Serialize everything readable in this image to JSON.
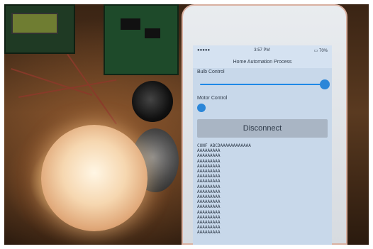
{
  "phone_app": {
    "status_time": "3:57 PM",
    "battery": "70%",
    "title": "Home Automation Process",
    "bulb_label": "Bulb Control",
    "bulb_slider_value": 1.0,
    "motor_label": "Motor Control",
    "disconnect_label": "Disconnect",
    "log_lines": [
      "CONF  ABCDAAAAAAAAAAAA",
      "AAAAAAAAA",
      "AAAAAAAAA",
      "AAAAAAAAA",
      "AAAAAAAAA",
      "AAAAAAAAA",
      "AAAAAAAAA",
      "AAAAAAAAA",
      "AAAAAAAAA",
      "AAAAAAAAA",
      "AAAAAAAAA",
      "AAAAAAAAA",
      "AAAAAAAAA",
      "AAAAAAAAA",
      "AAAAAAAAA",
      "AAAAAAAAA",
      "AAAAAAAAA",
      "AAAAAAAAA"
    ]
  }
}
